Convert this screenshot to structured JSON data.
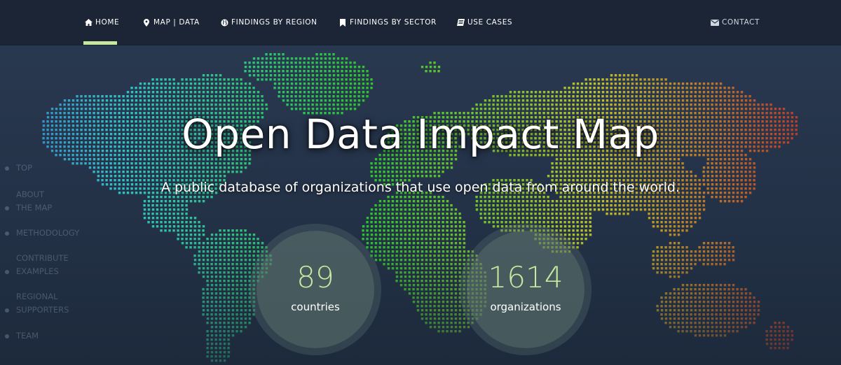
{
  "nav": {
    "items": [
      {
        "label": "HOME",
        "icon": "home-icon"
      },
      {
        "label": "MAP | DATA",
        "icon": "map-marker-icon"
      },
      {
        "label": "FINDINGS BY REGION",
        "icon": "globe-icon"
      },
      {
        "label": "FINDINGS BY SECTOR",
        "icon": "bookmark-icon"
      },
      {
        "label": "USE CASES",
        "icon": "book-icon"
      }
    ],
    "contact": {
      "label": "CONTACT",
      "icon": "envelope-icon"
    },
    "active_item": "HOME",
    "accent_color": "#c9e89f"
  },
  "side_nav": {
    "items": [
      {
        "label": "TOP"
      },
      {
        "label_line1": "ABOUT",
        "label_line2": "THE MAP"
      },
      {
        "label": "METHODOLOGY"
      },
      {
        "label_line1": "CONTRIBUTE",
        "label_line2": "EXAMPLES"
      },
      {
        "label_line1": "REGIONAL",
        "label_line2": "SUPPORTERS"
      },
      {
        "label": "TEAM"
      }
    ]
  },
  "hero": {
    "title": "Open Data Impact Map",
    "subtitle": "A public database of organizations that use open data from around the world."
  },
  "stats": [
    {
      "value": "89",
      "label": "countries"
    },
    {
      "value": "1614",
      "label": "organizations"
    }
  ],
  "colors": {
    "background": "#243248",
    "nav_background": "#1b2535",
    "stat_number": "#c9e89f"
  }
}
